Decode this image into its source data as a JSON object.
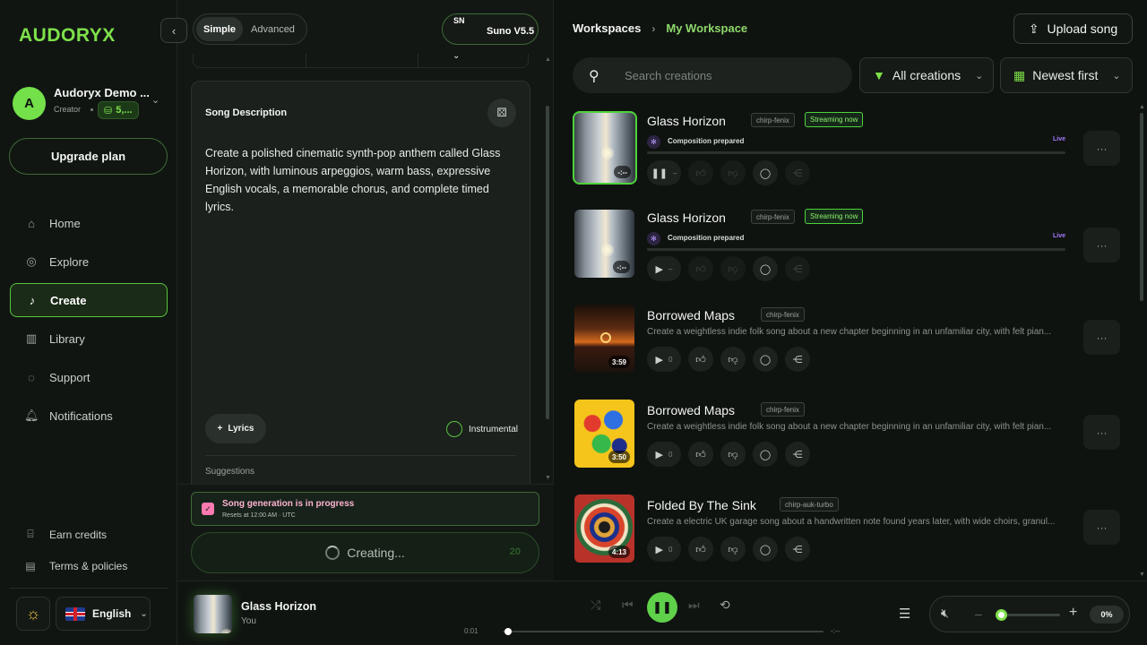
{
  "app": {
    "logo": "AUDORYX"
  },
  "sidebar": {
    "user": {
      "name": "Audoryx Demo ...",
      "role": "Creator",
      "credits": "5,...",
      "avatar_letter": "A"
    },
    "upgrade_label": "Upgrade plan",
    "nav": [
      {
        "label": "Home",
        "icon": "home-icon",
        "active": false
      },
      {
        "label": "Explore",
        "icon": "compass-icon",
        "active": false
      },
      {
        "label": "Create",
        "icon": "music-note-icon",
        "active": true
      },
      {
        "label": "Library",
        "icon": "library-icon",
        "active": false
      },
      {
        "label": "Support",
        "icon": "chat-icon",
        "active": false
      },
      {
        "label": "Notifications",
        "icon": "bell-icon",
        "active": false
      }
    ],
    "footer": [
      {
        "label": "Earn credits",
        "icon": "gift-icon"
      },
      {
        "label": "Terms & policies",
        "icon": "document-icon"
      }
    ],
    "language": "English"
  },
  "create": {
    "mode_simple": "Simple",
    "mode_advanced": "Advanced",
    "model_badge": "SN",
    "model_name": "Suno V5.5",
    "description_title": "Song Description",
    "description_text": "Create a polished cinematic synth-pop anthem called Glass Horizon, with luminous arpeggios, warm bass, expressive English vocals, a memorable chorus, and complete timed lyrics.",
    "lyrics_label": "Lyrics",
    "instrumental_label": "Instrumental",
    "suggestions_label": "Suggestions",
    "alert_title": "Song generation is in progress",
    "alert_sub": "Resets at 12:00 AM · UTC",
    "creating_label": "Creating...",
    "credit_cost": "20"
  },
  "workspace": {
    "breadcrumb_root": "Workspaces",
    "breadcrumb_current": "My Workspace",
    "upload_label": "Upload song",
    "search_placeholder": "Search creations",
    "filter_label": "All creations",
    "sort_label": "Newest first"
  },
  "songs": [
    {
      "title": "Glass Horizon",
      "model": "chirp-fenix",
      "status": "Streaming now",
      "composition": "Composition prepared",
      "live": "Live",
      "duration": "-:--",
      "play_count": "–",
      "playing": true
    },
    {
      "title": "Glass Horizon",
      "model": "chirp-fenix",
      "status": "Streaming now",
      "composition": "Composition prepared",
      "live": "Live",
      "duration": "-:--",
      "play_count": "–",
      "playing": false
    },
    {
      "title": "Borrowed Maps",
      "model": "chirp-fenix",
      "description": "Create a weightless indie folk song about a new chapter beginning in an unfamiliar city, with felt pian...",
      "duration": "3:59",
      "play_count": "0"
    },
    {
      "title": "Borrowed Maps",
      "model": "chirp-fenix",
      "description": "Create a weightless indie folk song about a new chapter beginning in an unfamiliar city, with felt pian...",
      "duration": "3:50",
      "play_count": "0"
    },
    {
      "title": "Folded By The Sink",
      "model": "chirp-auk-turbo",
      "description": "Create a electric UK garage song about a handwritten note found years later, with wide choirs, granul...",
      "duration": "4:13",
      "play_count": "0"
    }
  ],
  "player": {
    "title": "Glass Horizon",
    "artist": "You",
    "time_current": "0:01",
    "time_total": "-:--",
    "progress": 0.01,
    "volume_label": "0%",
    "volume": 0
  },
  "colors": {
    "accent": "#7ee04a",
    "active_border": "#5ac43d",
    "live": "#a57cff",
    "alert": "#ffb3d1"
  }
}
